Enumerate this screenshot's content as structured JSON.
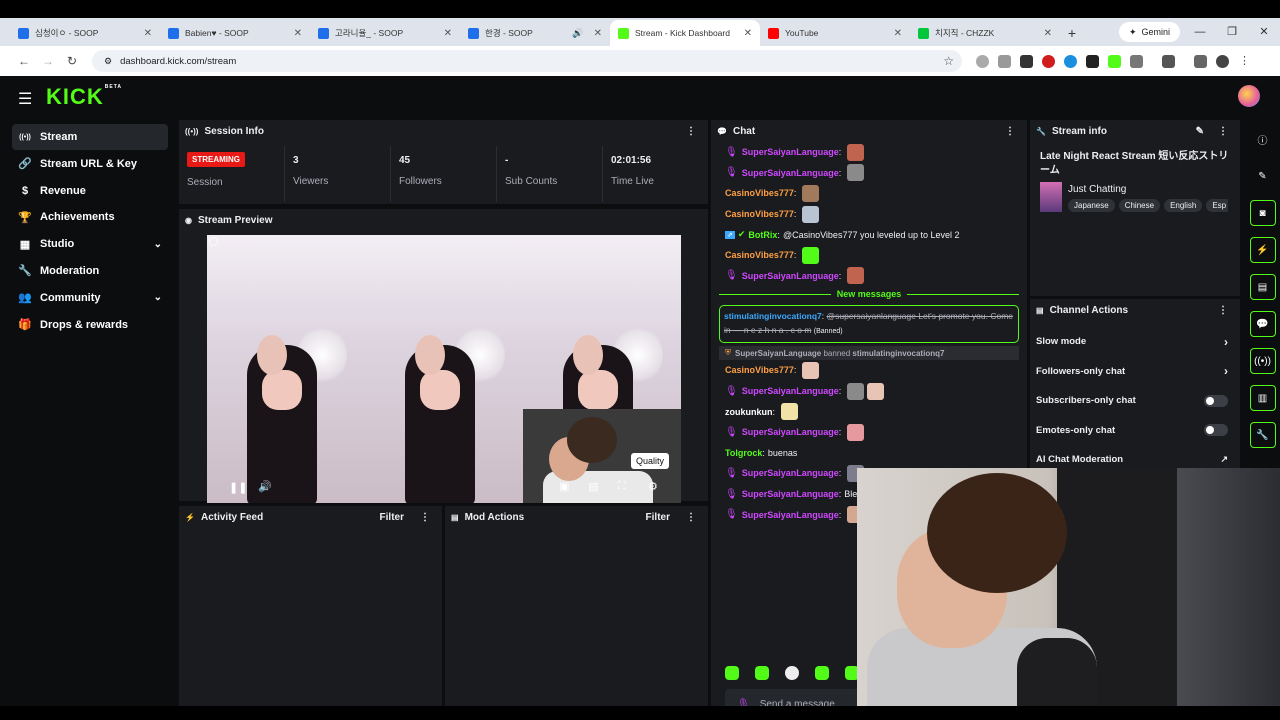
{
  "browser": {
    "tabs": [
      {
        "title": "심청이ㅇ - SOOP",
        "favicon_color": "#1f6feb",
        "active": false
      },
      {
        "title": "Babien♥ - SOOP",
        "favicon_color": "#1f6feb",
        "active": false
      },
      {
        "title": "고라니율_ - SOOP",
        "favicon_color": "#1f6feb",
        "active": false
      },
      {
        "title": "한경 - SOOP",
        "favicon_color": "#1f6feb",
        "active": false,
        "audio": true
      },
      {
        "title": "Stream - Kick Dashboard",
        "favicon_color": "#53fc18",
        "active": true
      },
      {
        "title": "YouTube",
        "favicon_color": "#ff0000",
        "active": false
      },
      {
        "title": "치지직 - CHZZK",
        "favicon_color": "#00c73c",
        "active": false
      }
    ],
    "gemini_label": "Gemini",
    "url": "dashboard.kick.com/stream"
  },
  "app": {
    "logo": "KICK",
    "logo_badge": "BETA"
  },
  "sidebar": {
    "items": [
      {
        "label": "Stream",
        "icon": "broadcast-icon",
        "glyph": "((•))",
        "active": true
      },
      {
        "label": "Stream URL & Key",
        "icon": "link-icon",
        "glyph": "🔗"
      },
      {
        "label": "Revenue",
        "icon": "dollar-icon",
        "glyph": "$"
      },
      {
        "label": "Achievements",
        "icon": "trophy-icon",
        "glyph": "🏆"
      },
      {
        "label": "Studio",
        "icon": "studio-icon",
        "glyph": "▦",
        "expandable": true
      },
      {
        "label": "Moderation",
        "icon": "wrench-icon",
        "glyph": "🔧"
      },
      {
        "label": "Community",
        "icon": "community-icon",
        "glyph": "👥",
        "expandable": true
      },
      {
        "label": "Drops & rewards",
        "icon": "gift-icon",
        "glyph": "🎁"
      }
    ]
  },
  "session": {
    "title": "Session Info",
    "badge": "STREAMING",
    "session_label": "Session",
    "viewers_value": "3",
    "viewers_label": "Viewers",
    "followers_value": "45",
    "followers_label": "Followers",
    "subs_value": "-",
    "subs_label": "Sub Counts",
    "time_value": "02:01:56",
    "time_label": "Time Live"
  },
  "preview": {
    "title": "Stream Preview",
    "tooltip": "Quality"
  },
  "activity": {
    "title": "Activity Feed",
    "filter": "Filter"
  },
  "modactions": {
    "title": "Mod Actions",
    "filter": "Filter"
  },
  "chat": {
    "title": "Chat",
    "messages_before": [
      {
        "user": "SuperSaiyanLanguage",
        "color": "#cf48ff",
        "mic": true,
        "text": "",
        "emotes": [
          "#c0634f"
        ]
      },
      {
        "user": "SuperSaiyanLanguage",
        "color": "#cf48ff",
        "mic": true,
        "text": "",
        "emotes": [
          "#8a8a8a"
        ]
      },
      {
        "user": "CasinoVibes777",
        "color": "#ff9f43",
        "mic": false,
        "text": "",
        "emotes": [
          "#a07a5a"
        ]
      },
      {
        "user": "CasinoVibes777",
        "color": "#ff9f43",
        "mic": false,
        "text": "",
        "emotes": [
          "#b8c4d4"
        ]
      },
      {
        "user": "BotRix",
        "color": "#53fc18",
        "mic": false,
        "bot": true,
        "text": "@CasinoVibes777 you leveled up to Level 2",
        "emotes": []
      },
      {
        "user": "CasinoVibes777",
        "color": "#ff9f43",
        "mic": false,
        "text": "",
        "emotes": [
          "#53fc18"
        ]
      },
      {
        "user": "SuperSaiyanLanguage",
        "color": "#cf48ff",
        "mic": true,
        "text": "",
        "emotes": [
          "#c0634f"
        ]
      }
    ],
    "new_messages_label": "New messages",
    "highlight": {
      "user": "stimulatinginvocationq7",
      "struck_text": "@supersaiyanlanguage Let's promote you. Come in — n e z h n a . c o m",
      "banned_label": "(Banned)"
    },
    "mod_line": {
      "mod": "SuperSaiyanLanguage",
      "action": "banned",
      "target": "stimulatinginvocationq7"
    },
    "messages_after": [
      {
        "user": "CasinoVibes777",
        "color": "#ff9f43",
        "mic": false,
        "text": "",
        "emotes": [
          "#e8c4b4"
        ]
      },
      {
        "user": "SuperSaiyanLanguage",
        "color": "#cf48ff",
        "mic": true,
        "text": "",
        "emotes": [
          "#8a8a8a",
          "#e8c4b4"
        ]
      },
      {
        "user": "zoukunkun",
        "color": "#ffffff",
        "mic": false,
        "text": "",
        "emotes": [
          "#f1e2a8"
        ]
      },
      {
        "user": "SuperSaiyanLanguage",
        "color": "#cf48ff",
        "mic": true,
        "text": "",
        "emotes": [
          "#e69aa0"
        ]
      },
      {
        "user": "Tolgrock",
        "color": "#53fc18",
        "mic": false,
        "text": "buenas",
        "emotes": []
      },
      {
        "user": "SuperSaiyanLanguage",
        "color": "#cf48ff",
        "mic": true,
        "text": "",
        "emotes": [
          "#7c7c8c"
        ]
      },
      {
        "user": "SuperSaiyanLanguage",
        "color": "#cf48ff",
        "mic": true,
        "text": "Bles",
        "emotes": []
      },
      {
        "user": "SuperSaiyanLanguage",
        "color": "#cf48ff",
        "mic": true,
        "text": "",
        "emotes": [
          "#d4a890"
        ]
      }
    ],
    "send_placeholder": "Send a message"
  },
  "stream_info": {
    "title": "Stream info",
    "stream_title": "Late Night React Stream 短い反応ストリーム",
    "category": "Just Chatting",
    "tags": [
      "Japanese",
      "Chinese",
      "English",
      "Esp"
    ]
  },
  "channel_actions": {
    "title": "Channel Actions",
    "rows": [
      {
        "label": "Slow mode",
        "kind": "chevron"
      },
      {
        "label": "Followers-only chat",
        "kind": "chevron"
      },
      {
        "label": "Subscribers-only chat",
        "kind": "toggle",
        "on": false
      },
      {
        "label": "Emotes-only chat",
        "kind": "toggle",
        "on": false
      },
      {
        "label": "AI Chat Moderation",
        "kind": "external"
      }
    ]
  },
  "accent_color": "#53fc18",
  "streaming_color": "#e91916"
}
